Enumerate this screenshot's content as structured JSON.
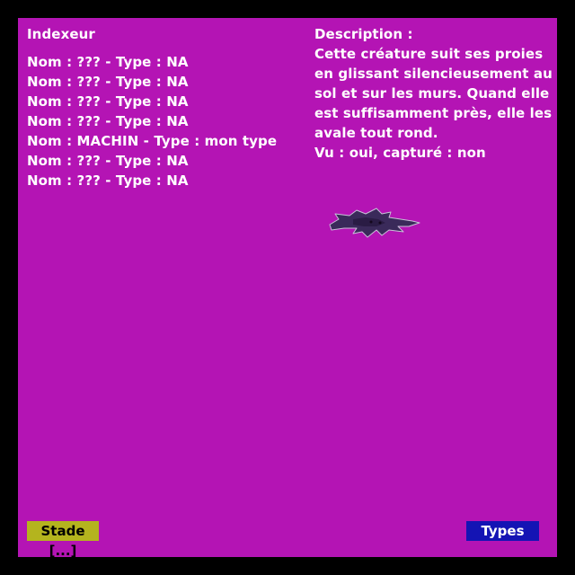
{
  "colors": {
    "background": "#000000",
    "panel": "#b414b4",
    "text": "#ffffff",
    "stade_button": "#b4b41e",
    "types_button": "#1414b4",
    "creature": "#3a2a5a"
  },
  "indexeur": {
    "title": "Indexeur",
    "entries": [
      "Nom : ??? - Type : NA",
      "Nom : ??? - Type : NA",
      "Nom : ??? - Type : NA",
      "Nom : ??? - Type : NA",
      "Nom : MACHIN - Type : mon type",
      "Nom : ??? - Type : NA",
      "Nom : ??? - Type : NA"
    ]
  },
  "description": {
    "title": "Description :",
    "lines": [
      "Cette créature suit ses proies",
      "en glissant silencieusement au",
      "sol et sur les murs. Quand elle",
      "est suffisamment près, elle les",
      "avale tout rond.",
      "Vu : oui, capturé : non"
    ]
  },
  "creature": {
    "icon": "shadow-creature-sprite"
  },
  "buttons": {
    "stade_label": "Stade [...]",
    "types_label": "Types"
  }
}
